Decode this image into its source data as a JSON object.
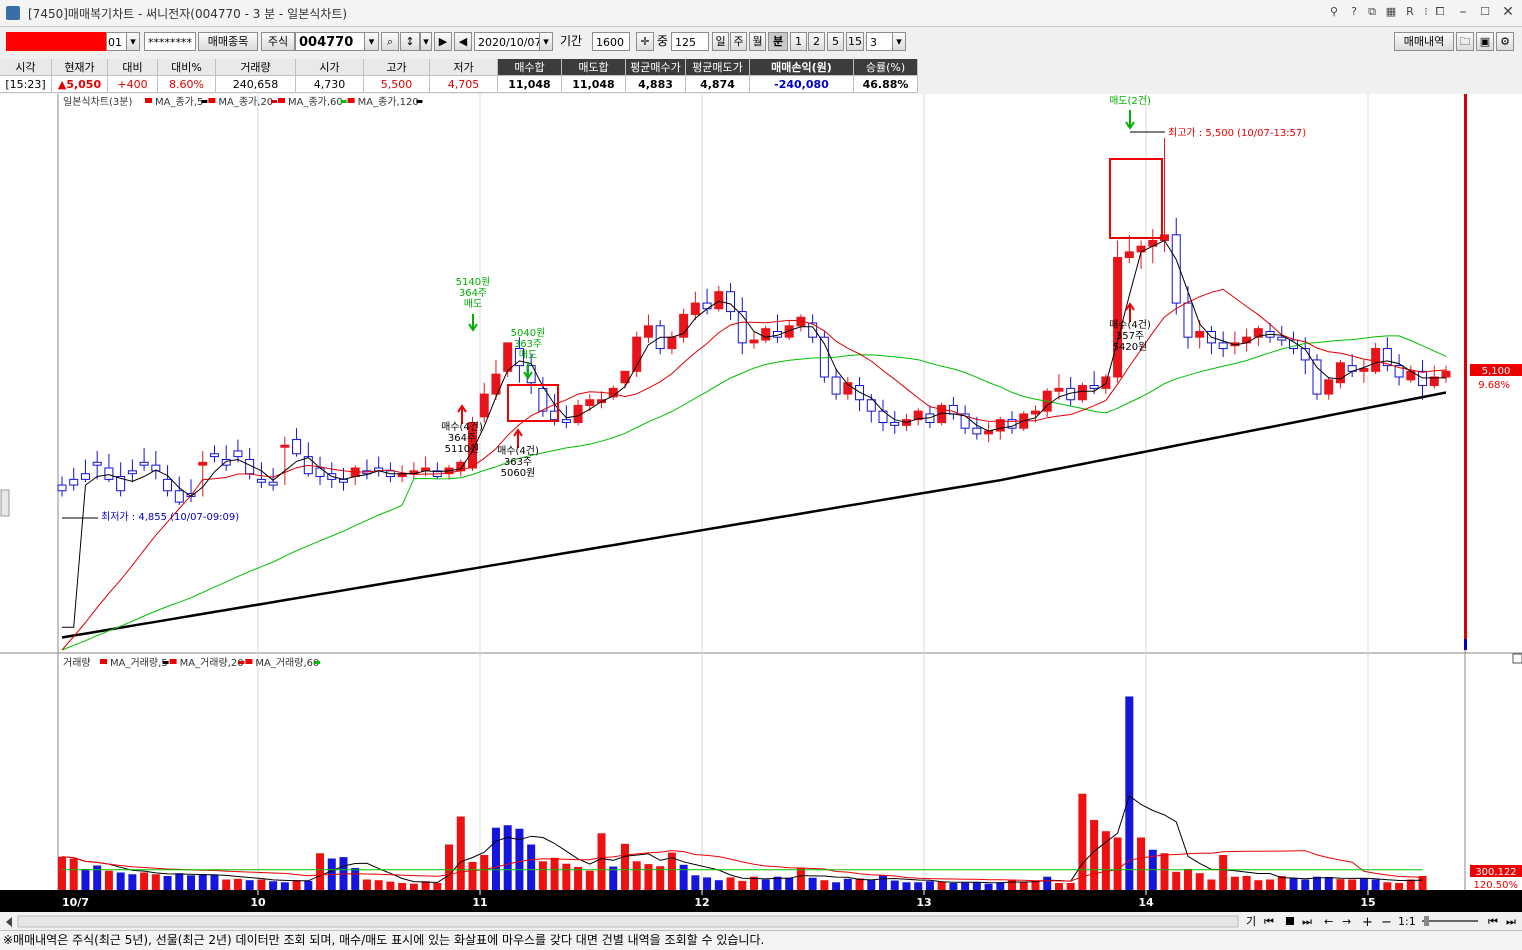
{
  "window": {
    "title": "[7450]매매복기차트 - 써니전자(004770 - 3 분 - 일본식차트)"
  },
  "toolbar": {
    "account_suffix": "01",
    "password_mask": "********",
    "trade_stock_button": "매매종목",
    "market_label": "주식",
    "stock_code": "004770",
    "date": "2020/10/07",
    "period_label": "기간",
    "period_value": "1600",
    "mid_label": "중",
    "mid_value": "125",
    "timeframes": [
      "일",
      "주",
      "월",
      "분",
      "1",
      "2",
      "5",
      "15"
    ],
    "minute_value": "3",
    "trade_history_button": "매매내역"
  },
  "info": {
    "headers": [
      "시각",
      "현재가",
      "대비",
      "대비%",
      "거래량",
      "시가",
      "고가",
      "저가",
      "매수합",
      "매도합",
      "평균매수가",
      "평균매도가",
      "매매손익(원)",
      "승률(%)"
    ],
    "values": [
      "[15:23]",
      "▲5,050",
      "+400",
      "8.60%",
      "240,658",
      "4,730",
      "5,500",
      "4,705",
      "11,048",
      "11,048",
      "4,883",
      "4,874",
      "-240,080",
      "46.88%"
    ]
  },
  "legend": {
    "price_title": "일본식차트(3분)",
    "price_mas": [
      {
        "label": "MA_종가,5",
        "color": "#000000"
      },
      {
        "label": "MA_종가,20",
        "color": "#e00000"
      },
      {
        "label": "MA_종가,60",
        "color": "#00c000"
      },
      {
        "label": "MA_종가,120",
        "color": "#000000"
      }
    ],
    "vol_title": "거래량",
    "vol_mas": [
      {
        "label": "MA_거래량,5",
        "color": "#000000"
      },
      {
        "label": "MA_거래량,20",
        "color": "#e00000"
      },
      {
        "label": "MA_거래량,60",
        "color": "#00c000"
      }
    ]
  },
  "annotations": {
    "high": "최고가 : 5,500 (10/07-13:57)",
    "low": "최저가 : 4,855 (10/07-09:09)",
    "sell1": "5140원\n364주\n매도",
    "sell2": "5040원\n363주\n매도",
    "sell3": "매도(2건)",
    "buy1": "매수(4건)\n364주\n5110원",
    "buy2": "매수(4건)\n363주\n5060원",
    "buy3": "매수(4건)\n357주\n5420원"
  },
  "price_axis": {
    "current_label": "5,100",
    "pct_label": "9.68%"
  },
  "volume_axis": {
    "current_label": "300,122",
    "pct_label": "120.50%"
  },
  "x_axis": {
    "labels": [
      "10/7",
      "10",
      "11",
      "12",
      "13",
      "14",
      "15"
    ]
  },
  "bottom_controls": {
    "ratio": "1:1"
  },
  "status_text": "※매매내역은 주식(최근 5년), 선물(최근 2년) 데이터만 조회 되며, 매수/매도 표시에 있는 화살표에 마우스를 갖다 대면 건별 내역을 조회할 수 있습니다.",
  "chart_data": {
    "type": "candlestick",
    "ylim": [
      4600,
      5560
    ],
    "up_color": "#e8141b",
    "down_color": "#1010d8",
    "candles": [
      [
        4890,
        4905,
        4880,
        4870
      ],
      [
        4900,
        4920,
        4890,
        4880
      ],
      [
        4910,
        4935,
        4900,
        4895
      ],
      [
        4930,
        4950,
        4925,
        4900
      ],
      [
        4920,
        4945,
        4900,
        4895
      ],
      [
        4905,
        4930,
        4880,
        4870
      ],
      [
        4915,
        4935,
        4910,
        4895
      ],
      [
        4930,
        4955,
        4925,
        4915
      ],
      [
        4925,
        4950,
        4915,
        4900
      ],
      [
        4900,
        4925,
        4880,
        4870
      ],
      [
        4880,
        4905,
        4860,
        4855
      ],
      [
        4875,
        4900,
        4870,
        4860
      ],
      [
        4925,
        4950,
        4930,
        4870
      ],
      [
        4945,
        4960,
        4940,
        4930
      ],
      [
        4935,
        4960,
        4925,
        4915
      ],
      [
        4950,
        4970,
        4940,
        4930
      ],
      [
        4935,
        4955,
        4910,
        4900
      ],
      [
        4900,
        4930,
        4895,
        4885
      ],
      [
        4895,
        4920,
        4890,
        4880
      ],
      [
        4960,
        4975,
        4960,
        4890
      ],
      [
        4970,
        4990,
        4945,
        4940
      ],
      [
        4940,
        4965,
        4910,
        4905
      ],
      [
        4920,
        4940,
        4905,
        4890
      ],
      [
        4910,
        4930,
        4900,
        4885
      ],
      [
        4900,
        4920,
        4895,
        4880
      ],
      [
        4905,
        4925,
        4920,
        4890
      ],
      [
        4915,
        4935,
        4910,
        4900
      ],
      [
        4920,
        4940,
        4915,
        4905
      ],
      [
        4915,
        4930,
        4905,
        4895
      ],
      [
        4905,
        4925,
        4910,
        4895
      ],
      [
        4910,
        4930,
        4915,
        4900
      ],
      [
        4915,
        4940,
        4920,
        4905
      ],
      [
        4915,
        4930,
        4905,
        4900
      ],
      [
        4910,
        4925,
        4920,
        4900
      ],
      [
        4915,
        4935,
        4930,
        4905
      ],
      [
        4920,
        5010,
        5000,
        4915
      ],
      [
        5010,
        5070,
        5050,
        5000
      ],
      [
        5050,
        5110,
        5085,
        5040
      ],
      [
        5090,
        5140,
        5140,
        5080
      ],
      [
        5130,
        5150,
        5100,
        5070
      ],
      [
        5100,
        5120,
        5070,
        5050
      ],
      [
        5060,
        5080,
        5020,
        5010
      ],
      [
        5020,
        5050,
        5005,
        4995
      ],
      [
        5005,
        5030,
        5000,
        4990
      ],
      [
        5000,
        5040,
        5030,
        4995
      ],
      [
        5030,
        5050,
        5040,
        5020
      ],
      [
        5035,
        5055,
        5040,
        5025
      ],
      [
        5045,
        5065,
        5060,
        5040
      ],
      [
        5070,
        5090,
        5090,
        5060
      ],
      [
        5090,
        5160,
        5150,
        5080
      ],
      [
        5150,
        5190,
        5170,
        5140
      ],
      [
        5170,
        5180,
        5130,
        5120
      ],
      [
        5130,
        5160,
        5150,
        5120
      ],
      [
        5150,
        5200,
        5190,
        5140
      ],
      [
        5190,
        5230,
        5210,
        5180
      ],
      [
        5210,
        5235,
        5200,
        5190
      ],
      [
        5200,
        5240,
        5230,
        5195
      ],
      [
        5230,
        5245,
        5195,
        5180
      ],
      [
        5195,
        5220,
        5140,
        5120
      ],
      [
        5140,
        5160,
        5145,
        5130
      ],
      [
        5145,
        5170,
        5165,
        5140
      ],
      [
        5160,
        5190,
        5150,
        5140
      ],
      [
        5150,
        5180,
        5170,
        5145
      ],
      [
        5170,
        5190,
        5185,
        5160
      ],
      [
        5175,
        5190,
        5150,
        5140
      ],
      [
        5150,
        5160,
        5080,
        5070
      ],
      [
        5080,
        5095,
        5050,
        5040
      ],
      [
        5050,
        5080,
        5070,
        5040
      ],
      [
        5065,
        5080,
        5040,
        5020
      ],
      [
        5040,
        5050,
        5020,
        5000
      ],
      [
        5020,
        5040,
        5000,
        4985
      ],
      [
        5000,
        5020,
        4995,
        4980
      ],
      [
        4995,
        5015,
        5005,
        4985
      ],
      [
        5005,
        5025,
        5020,
        4995
      ],
      [
        5015,
        5030,
        5000,
        4990
      ],
      [
        5000,
        5035,
        5030,
        4995
      ],
      [
        5030,
        5045,
        5015,
        5005
      ],
      [
        5015,
        5030,
        4990,
        4980
      ],
      [
        4990,
        5010,
        4980,
        4970
      ],
      [
        4980,
        5000,
        4985,
        4965
      ],
      [
        4985,
        5010,
        5005,
        4970
      ],
      [
        5005,
        5020,
        4990,
        4980
      ],
      [
        4990,
        5020,
        5015,
        4985
      ],
      [
        5015,
        5030,
        5020,
        5000
      ],
      [
        5020,
        5060,
        5055,
        5010
      ],
      [
        5055,
        5085,
        5060,
        5040
      ],
      [
        5060,
        5080,
        5040,
        5030
      ],
      [
        5040,
        5070,
        5065,
        5035
      ],
      [
        5065,
        5090,
        5060,
        5050
      ],
      [
        5060,
        5085,
        5080,
        5050
      ],
      [
        5080,
        5320,
        5290,
        5070
      ],
      [
        5290,
        5330,
        5300,
        5280
      ],
      [
        5300,
        5320,
        5310,
        5270
      ],
      [
        5310,
        5340,
        5320,
        5280
      ],
      [
        5320,
        5500,
        5330,
        5300
      ],
      [
        5330,
        5360,
        5210,
        5190
      ],
      [
        5210,
        5240,
        5150,
        5130
      ],
      [
        5150,
        5180,
        5160,
        5130
      ],
      [
        5160,
        5170,
        5140,
        5120
      ],
      [
        5140,
        5160,
        5130,
        5115
      ],
      [
        5135,
        5160,
        5140,
        5120
      ],
      [
        5140,
        5165,
        5150,
        5125
      ],
      [
        5150,
        5170,
        5165,
        5135
      ],
      [
        5160,
        5175,
        5150,
        5140
      ],
      [
        5150,
        5170,
        5145,
        5135
      ],
      [
        5145,
        5160,
        5130,
        5120
      ],
      [
        5130,
        5150,
        5110,
        5085
      ],
      [
        5110,
        5120,
        5050,
        5040
      ],
      [
        5050,
        5080,
        5075,
        5040
      ],
      [
        5070,
        5110,
        5105,
        5060
      ],
      [
        5100,
        5120,
        5090,
        5080
      ],
      [
        5090,
        5110,
        5095,
        5070
      ],
      [
        5090,
        5140,
        5130,
        5085
      ],
      [
        5130,
        5150,
        5100,
        5090
      ],
      [
        5100,
        5120,
        5080,
        5065
      ],
      [
        5075,
        5100,
        5090,
        5070
      ],
      [
        5090,
        5110,
        5065,
        5040
      ],
      [
        5065,
        5100,
        5080,
        5060
      ],
      [
        5080,
        5100,
        5090,
        5070
      ]
    ],
    "volumes": [
      [
        95000,
        1
      ],
      [
        90000,
        1
      ],
      [
        60000,
        0
      ],
      [
        70000,
        0
      ],
      [
        55000,
        1
      ],
      [
        50000,
        0
      ],
      [
        45000,
        0
      ],
      [
        50000,
        1
      ],
      [
        45000,
        1
      ],
      [
        40000,
        0
      ],
      [
        48000,
        0
      ],
      [
        42000,
        0
      ],
      [
        45000,
        0
      ],
      [
        44000,
        0
      ],
      [
        30000,
        1
      ],
      [
        32000,
        1
      ],
      [
        28000,
        0
      ],
      [
        30000,
        1
      ],
      [
        25000,
        0
      ],
      [
        22000,
        0
      ],
      [
        28000,
        1
      ],
      [
        26000,
        0
      ],
      [
        105000,
        1
      ],
      [
        90000,
        0
      ],
      [
        94000,
        0
      ],
      [
        63000,
        0
      ],
      [
        30000,
        1
      ],
      [
        28000,
        1
      ],
      [
        24000,
        1
      ],
      [
        20000,
        1
      ],
      [
        18000,
        1
      ],
      [
        25000,
        1
      ],
      [
        20000,
        1
      ],
      [
        130000,
        1
      ],
      [
        210000,
        1
      ],
      [
        80000,
        1
      ],
      [
        100000,
        1
      ],
      [
        178000,
        0
      ],
      [
        185000,
        0
      ],
      [
        175000,
        0
      ],
      [
        130000,
        0
      ],
      [
        82000,
        1
      ],
      [
        92000,
        1
      ],
      [
        75000,
        1
      ],
      [
        66000,
        1
      ],
      [
        55000,
        1
      ],
      [
        162000,
        1
      ],
      [
        67000,
        0
      ],
      [
        132000,
        1
      ],
      [
        82000,
        1
      ],
      [
        74000,
        1
      ],
      [
        68000,
        1
      ],
      [
        107000,
        1
      ],
      [
        72000,
        0
      ],
      [
        42000,
        0
      ],
      [
        36000,
        0
      ],
      [
        28000,
        0
      ],
      [
        36000,
        1
      ],
      [
        26000,
        1
      ],
      [
        38000,
        1
      ],
      [
        30000,
        0
      ],
      [
        38000,
        0
      ],
      [
        35000,
        0
      ],
      [
        64000,
        1
      ],
      [
        35000,
        0
      ],
      [
        28000,
        1
      ],
      [
        22000,
        0
      ],
      [
        32000,
        0
      ],
      [
        33000,
        1
      ],
      [
        30000,
        0
      ],
      [
        42000,
        0
      ],
      [
        27000,
        0
      ],
      [
        22000,
        0
      ],
      [
        22000,
        0
      ],
      [
        25000,
        0
      ],
      [
        23000,
        1
      ],
      [
        20000,
        0
      ],
      [
        21000,
        0
      ],
      [
        23000,
        0
      ],
      [
        18000,
        0
      ],
      [
        22000,
        0
      ],
      [
        30000,
        1
      ],
      [
        22000,
        1
      ],
      [
        26000,
        1
      ],
      [
        38000,
        0
      ],
      [
        20000,
        1
      ],
      [
        20000,
        1
      ],
      [
        275000,
        1
      ],
      [
        200000,
        1
      ],
      [
        168000,
        1
      ],
      [
        150000,
        1
      ],
      [
        553000,
        0
      ],
      [
        150000,
        1
      ],
      [
        115000,
        0
      ],
      [
        105000,
        1
      ],
      [
        52000,
        1
      ],
      [
        60000,
        1
      ],
      [
        48000,
        1
      ],
      [
        30000,
        1
      ],
      [
        100000,
        1
      ],
      [
        38000,
        1
      ],
      [
        40000,
        1
      ],
      [
        28000,
        1
      ],
      [
        30000,
        1
      ],
      [
        40000,
        1
      ],
      [
        33000,
        0
      ],
      [
        30000,
        0
      ],
      [
        38000,
        0
      ],
      [
        37000,
        0
      ],
      [
        31000,
        1
      ],
      [
        30000,
        1
      ],
      [
        33000,
        0
      ],
      [
        30000,
        0
      ],
      [
        22000,
        1
      ],
      [
        20000,
        1
      ],
      [
        30000,
        1
      ],
      [
        40000,
        1
      ]
    ],
    "volume_ylim": [
      0,
      640000
    ]
  }
}
